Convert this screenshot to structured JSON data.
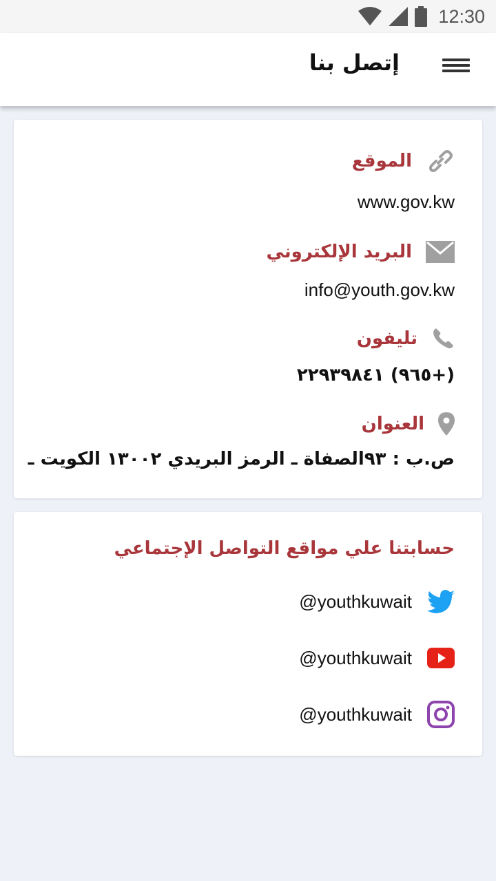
{
  "status_bar": {
    "time": "12:30"
  },
  "header": {
    "title": "إتصل بنا"
  },
  "contact": {
    "website": {
      "label": "الموقع",
      "value": "www.gov.kw",
      "icon": "link-icon"
    },
    "email": {
      "label": "البريد الإلكتروني",
      "value": "info@youth.gov.kw",
      "icon": "envelope-icon"
    },
    "phone": {
      "label": "تليفون",
      "value": "(+٩٦٥) ٢٢٩٣٩٨٤١",
      "icon": "phone-icon"
    },
    "address": {
      "label": "العنوان",
      "value": "ص.ب : ٩٣الصفاة ـ الرمز البريدي ١٣٠٠٢ الكويت ـ",
      "icon": "map-pin-icon"
    }
  },
  "social": {
    "title": "حسابتنا علي مواقع التواصل الإجتماعي",
    "accounts": [
      {
        "network": "twitter",
        "handle": "@youthkuwait",
        "icon": "twitter-icon",
        "color": "#1da1f2"
      },
      {
        "network": "youtube",
        "handle": "@youthkuwait",
        "icon": "youtube-icon",
        "color": "#e62117"
      },
      {
        "network": "instagram",
        "handle": "@youthkuwait",
        "icon": "instagram-icon",
        "color": "#8e44ad"
      }
    ]
  },
  "colors": {
    "accent": "#a8363b",
    "icon_gray": "#a0a0a0",
    "background": "#eef2f8"
  }
}
